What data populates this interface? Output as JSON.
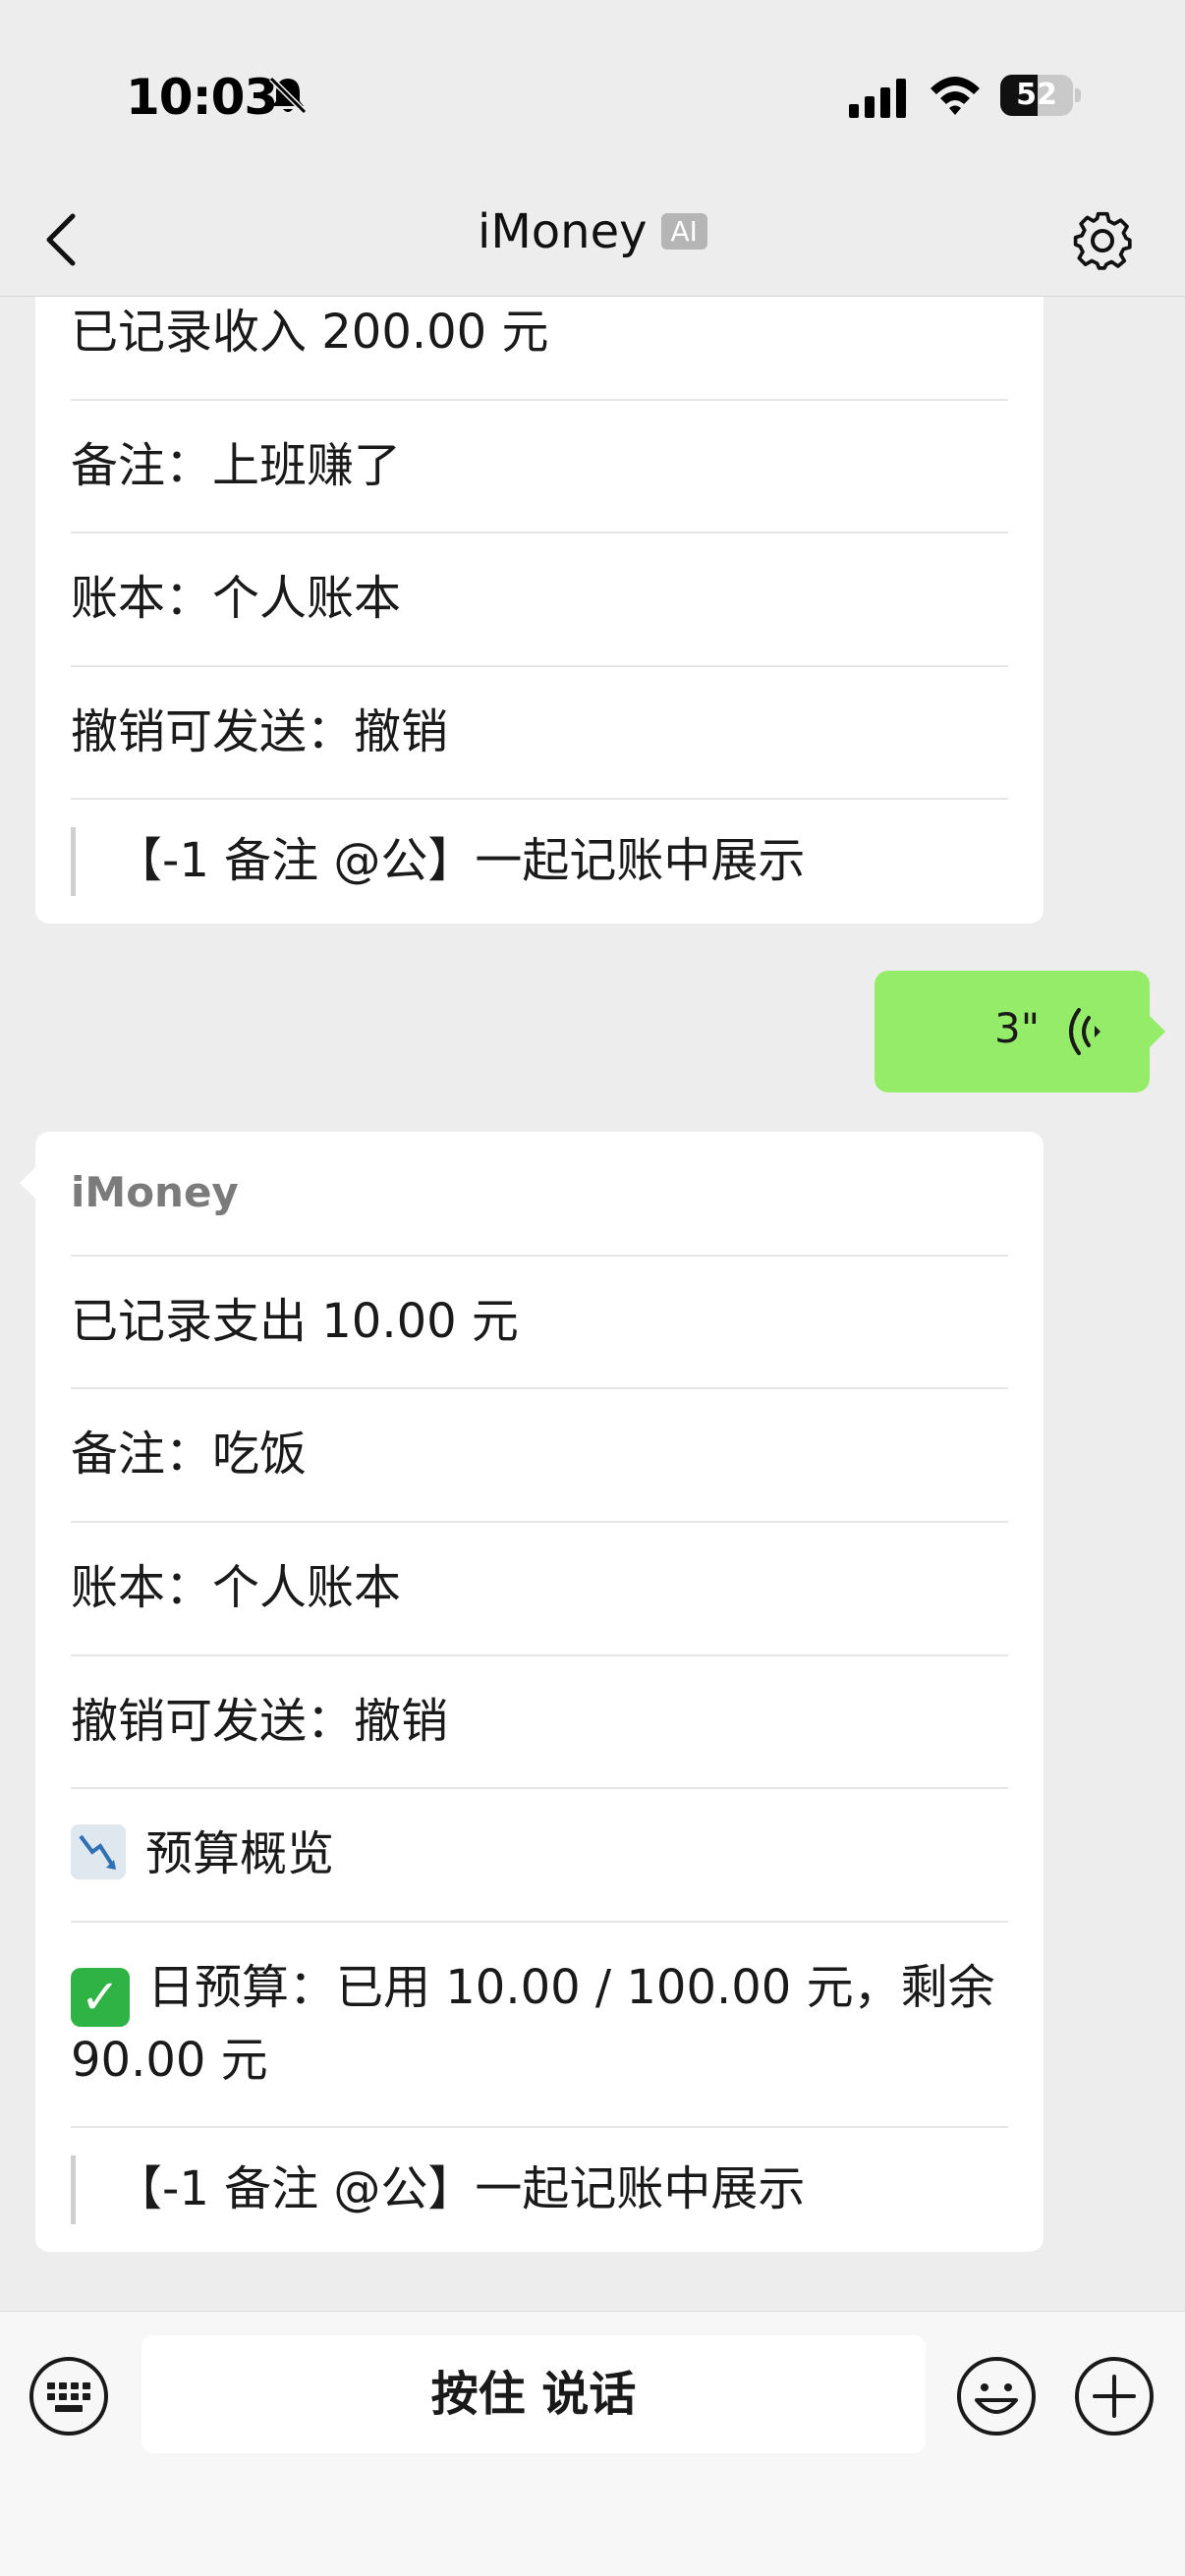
{
  "status_bar": {
    "time": "10:03",
    "battery_level": "52",
    "battery_fraction": 0.52
  },
  "header": {
    "title": "iMoney",
    "badge": "AI",
    "back_icon": "chevron-left-icon",
    "settings_icon": "gear-icon"
  },
  "messages": [
    {
      "type": "bot_card",
      "rows": [
        "已记录收入 200.00 元",
        "备注：上班赚了",
        "账本：个人账本",
        "撤销可发送：撤销"
      ],
      "quote": "【-1 备注 @公】一起记账中展示"
    },
    {
      "type": "voice",
      "duration": "3\""
    },
    {
      "type": "bot_card",
      "sender": "iMoney",
      "rows": [
        "已记录支出 10.00 元",
        "备注：吃饭",
        "账本：个人账本",
        "撤销可发送：撤销"
      ],
      "budget_title": "预算概览",
      "budget_line": "日预算：已用 10.00 / 100.00 元，剩余 90.00 元",
      "quote": "【-1 备注 @公】一起记账中展示"
    }
  ],
  "input_bar": {
    "hold_to_talk": "按住 说话",
    "icons": [
      "keyboard-icon",
      "emoji-icon",
      "plus-icon"
    ]
  },
  "colors": {
    "background": "#ededed",
    "voice_bubble": "#95ec69",
    "card": "#ffffff",
    "check_emoji": "#2fb344"
  }
}
